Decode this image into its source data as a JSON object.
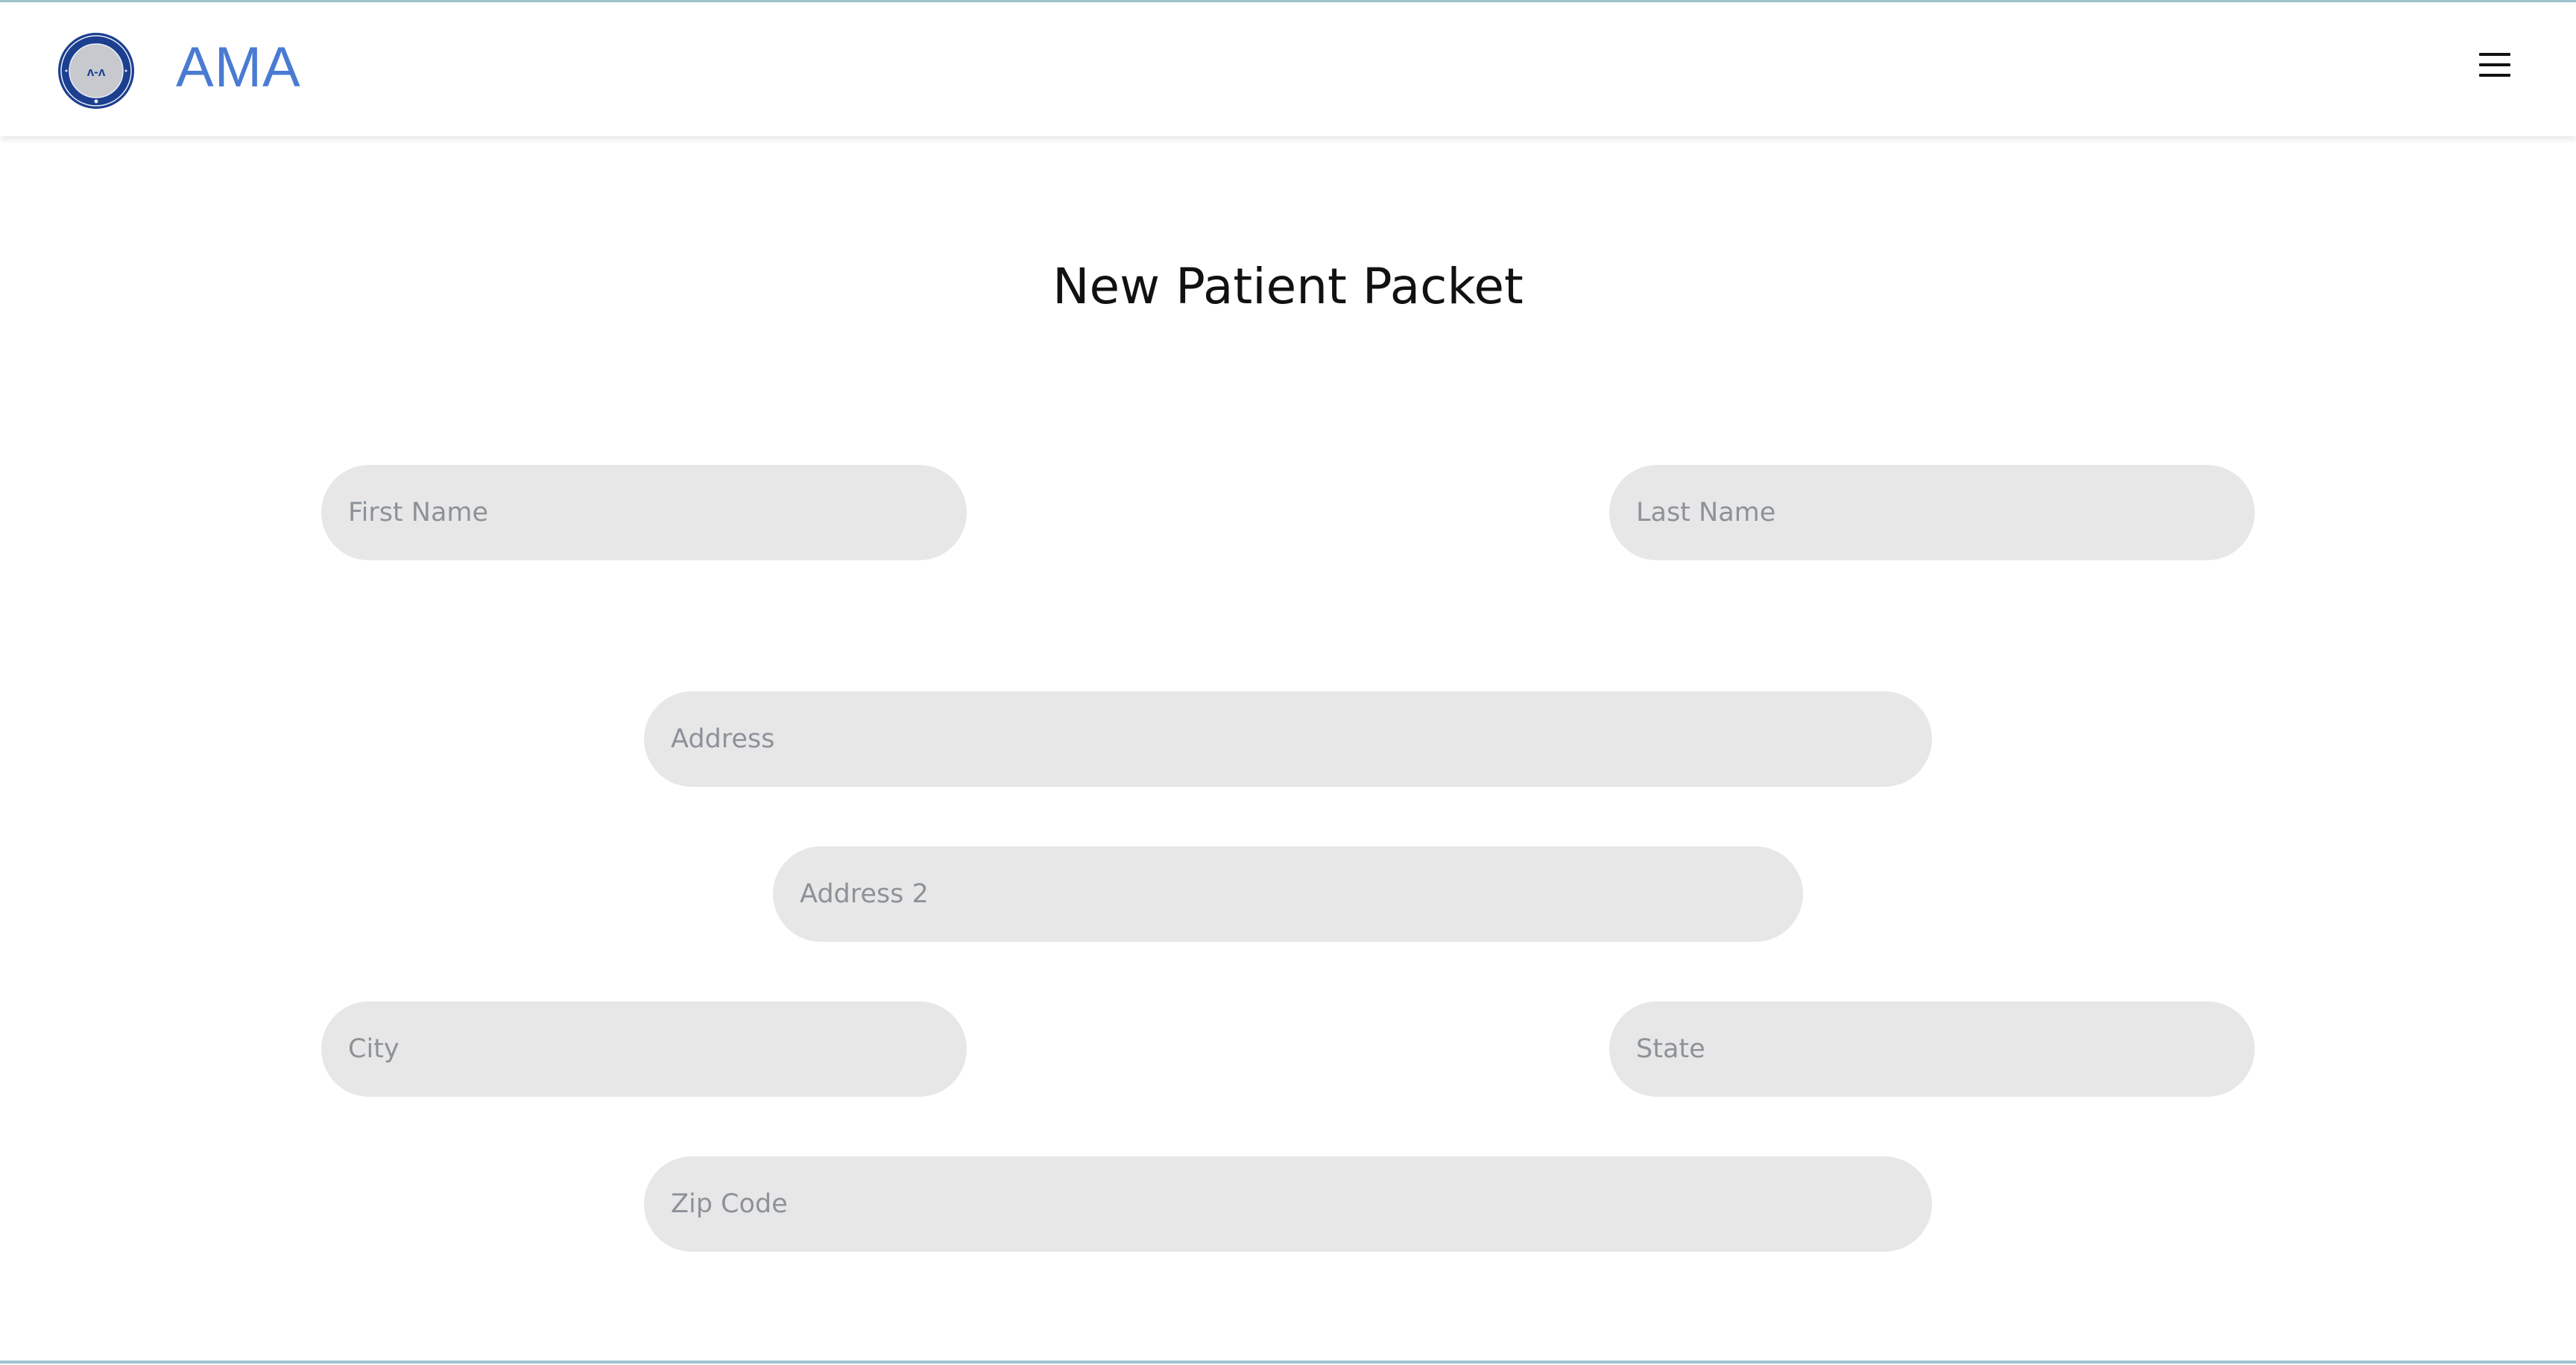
{
  "header": {
    "brand": "AMA",
    "logo_icon": "ama-seal-logo",
    "logo_text": "AMERICAN MEDICAL ASSOCIATION",
    "menu_icon": "hamburger-menu-icon"
  },
  "form": {
    "title": "New Patient Packet",
    "fields": {
      "first_name": {
        "placeholder": "First Name",
        "value": ""
      },
      "last_name": {
        "placeholder": "Last Name",
        "value": ""
      },
      "address": {
        "placeholder": "Address",
        "value": ""
      },
      "address2": {
        "placeholder": "Address 2",
        "value": ""
      },
      "city": {
        "placeholder": "City",
        "value": ""
      },
      "state": {
        "placeholder": "State",
        "value": ""
      },
      "zip": {
        "placeholder": "Zip Code",
        "value": ""
      }
    }
  },
  "colors": {
    "brand": "#4a7bd3",
    "field_background": "#e7e7e7",
    "placeholder": "#8d9299",
    "border_accent": "#9fc3cf"
  }
}
